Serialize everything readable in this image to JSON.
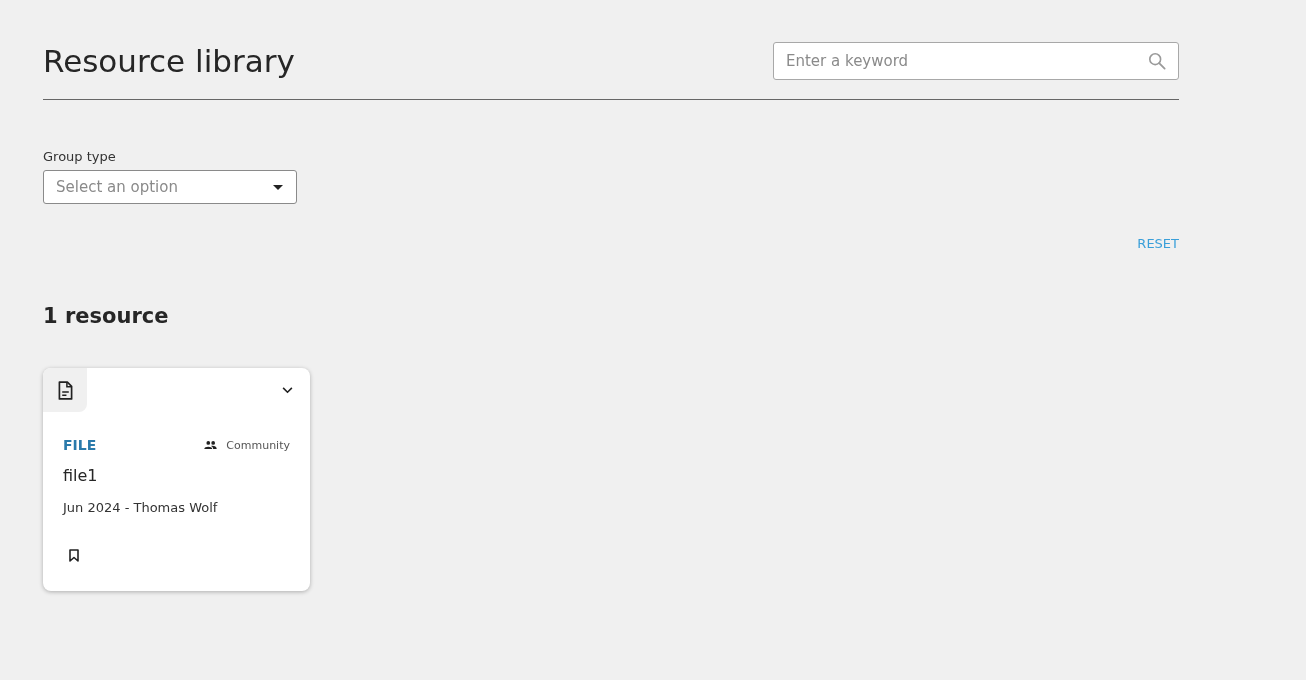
{
  "header": {
    "title": "Resource library",
    "search": {
      "placeholder": "Enter a keyword"
    }
  },
  "filters": [
    {
      "label": "Group type",
      "placeholder": "Select an option"
    }
  ],
  "reset_link": "RESET",
  "results": {
    "count": "1 resource",
    "cards": [
      {
        "type": "FILE",
        "audience": "Community",
        "title": "file1",
        "meta": "Jun 2024 - Thomas Wolf",
        "bookmarked": false
      }
    ]
  }
}
